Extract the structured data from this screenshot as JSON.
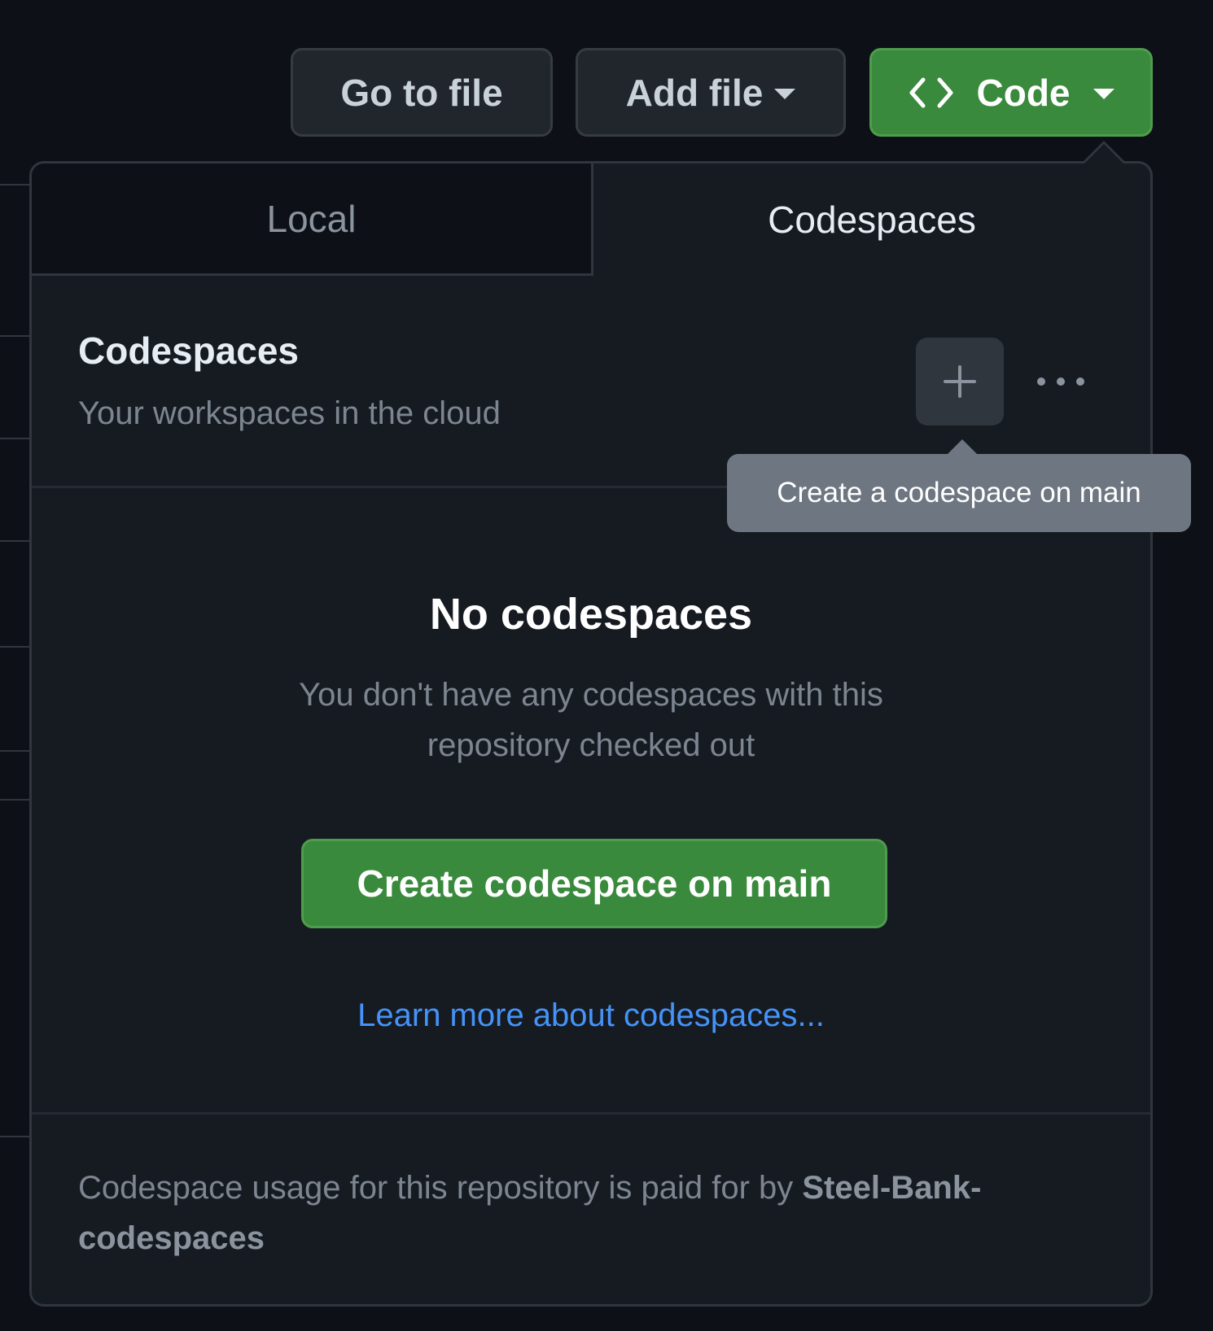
{
  "toolbar": {
    "go_to_file": "Go to file",
    "add_file": "Add file",
    "code": "Code"
  },
  "dropdown": {
    "tabs": [
      {
        "label": "Local",
        "selected": false
      },
      {
        "label": "Codespaces",
        "selected": true
      }
    ],
    "section": {
      "title": "Codespaces",
      "subtitle": "Your workspaces in the cloud"
    },
    "empty_state": {
      "title": "No codespaces",
      "description": "You don't have any codespaces with this repository checked out",
      "create_button": "Create codespace on main",
      "learn_more": "Learn more about codespaces..."
    },
    "footer": {
      "text": "Codespace usage for this repository is paid for by",
      "org": "Steel-Bank-codespaces"
    }
  },
  "tooltip": {
    "text": "Create a codespace on main"
  },
  "icons": {
    "code": "code-icon",
    "plus": "plus-icon",
    "kebab": "kebab-horizontal-icon",
    "caret": "triangle-down-icon"
  },
  "colors": {
    "background": "#0d1117",
    "panel": "#161b22",
    "primary": "#3a8a3d",
    "link": "#4493f8",
    "tooltip": "#6e7681"
  }
}
